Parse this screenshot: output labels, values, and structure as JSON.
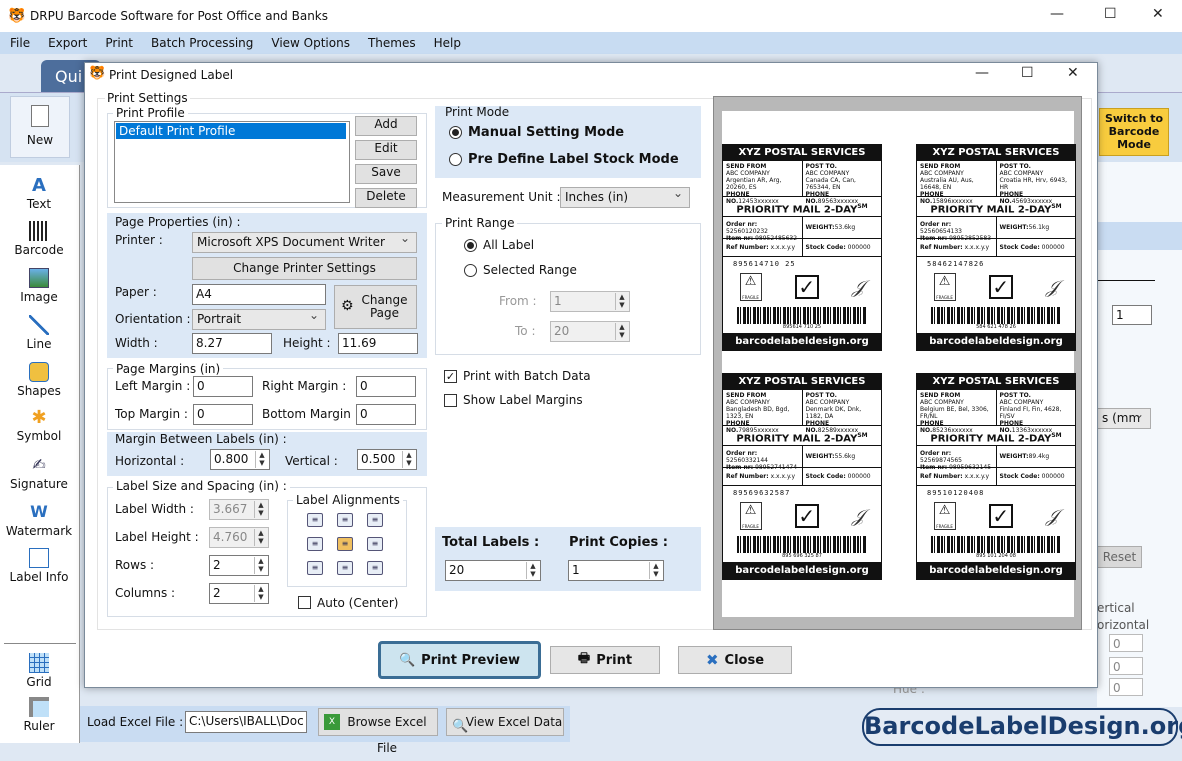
{
  "app": {
    "title": "DRPU Barcode Software for Post Office and Banks",
    "quick_tab": "Qui",
    "new_label": "New",
    "switch_mode": "Switch to Barcode Mode"
  },
  "menu": [
    "File",
    "Export",
    "Print",
    "Batch Processing",
    "View Options",
    "Themes",
    "Help"
  ],
  "sidebar": {
    "items": [
      "Text",
      "Barcode",
      "Image",
      "Line",
      "Shapes",
      "Symbol",
      "Signature",
      "Watermark",
      "Label Info"
    ],
    "bottom": [
      "Grid",
      "Ruler"
    ]
  },
  "background": {
    "load_excel_label": "Load Excel File :",
    "excel_path": "C:\\Users\\IBALL\\Doc",
    "browse_excel": "Browse Excel File",
    "view_excel": "View Excel Data",
    "right": {
      "reset": "Reset",
      "vertical": "ertical",
      "horizontal": "orizontal",
      "spin_value": "1",
      "units": "s (mm",
      "hue": "Hue :",
      "zero": "0"
    }
  },
  "dialog": {
    "title": "Print Designed Label",
    "print_settings": "Print Settings",
    "print_profile": {
      "title": "Print Profile",
      "items": [
        "Default Print Profile"
      ],
      "add": "Add",
      "edit": "Edit",
      "save": "Save",
      "delete": "Delete"
    },
    "page_properties": {
      "title": "Page Properties (in) :",
      "printer_label": "Printer :",
      "printer": "Microsoft XPS Document Writer",
      "change_printer": "Change Printer Settings",
      "paper_label": "Paper :",
      "paper": "A4",
      "change_page": "Change Page",
      "orientation_label": "Orientation :",
      "orientation": "Portrait",
      "width_label": "Width :",
      "width": "8.27",
      "height_label": "Height :",
      "height": "11.69"
    },
    "page_margins": {
      "title": "Page Margins (in)",
      "left_label": "Left Margin :",
      "left": "0",
      "right_label": "Right Margin :",
      "right": "0",
      "top_label": "Top Margin :",
      "top": "0",
      "bottom_label": "Bottom Margin :",
      "bottom": "0"
    },
    "margin_between": {
      "title": "Margin Between Labels (in) :",
      "horizontal_label": "Horizontal :",
      "horizontal": "0.800",
      "vertical_label": "Vertical :",
      "vertical": "0.500"
    },
    "label_size": {
      "title": "Label Size and Spacing (in) :",
      "width_label": "Label Width :",
      "width": "3.667",
      "height_label": "Label Height :",
      "height": "4.760",
      "rows_label": "Rows :",
      "rows": "2",
      "columns_label": "Columns :",
      "columns": "2",
      "alignments_title": "Label Alignments",
      "selected_alignment": "middle-center",
      "auto_center": "Auto (Center)"
    },
    "print_mode": {
      "title": "Print Mode",
      "manual": "Manual Setting Mode",
      "predefine": "Pre Define Label Stock Mode",
      "selected": "manual"
    },
    "measurement": {
      "label": "Measurement Unit :",
      "value": "Inches (in)"
    },
    "print_range": {
      "title": "Print Range",
      "all": "All Label",
      "selected": "Selected Range",
      "from_label": "From :",
      "from": "1",
      "to_label": "To :",
      "to": "20"
    },
    "batch": {
      "print_with_batch": "Print with Batch Data",
      "print_with_batch_checked": true,
      "show_margins": "Show Label Margins",
      "show_margins_checked": false
    },
    "totals": {
      "total_label": "Total Labels :",
      "total": "20",
      "copies_label": "Print Copies :",
      "copies": "1"
    },
    "buttons": {
      "preview": "Print Preview",
      "print": "Print",
      "close": "Close"
    }
  },
  "labels": [
    {
      "header": "XYZ POSTAL SERVICES",
      "send_from": "SEND FROM",
      "sender": "ABC COMPANY",
      "sender_addr": "Argentian AR, Arg, 20260, ES",
      "sender_phone_label": "PHONE NO.",
      "sender_phone": "12453xxxxxx",
      "post_to": "POST TO.",
      "recipient": "ABC COMPANY",
      "recipient_addr": "Canada CA, Can, 765344, EN",
      "recipient_phone_label": "PHONE NO.",
      "recipient_phone": "89563xxxxxx",
      "service": "PRIORITY MAIL 2-DAY",
      "sm": "SM",
      "order_label": "Order nr:",
      "order": "52560120232",
      "item_label": "Item nr:",
      "item": "98952485632",
      "weight_label": "WEIGHT:",
      "weight": "53.6kg",
      "ref_label": "Ref Number:",
      "ref": "x.x.x.y.y",
      "stock_label": "Stock Code:",
      "stock": "000000",
      "code": "895614710 25",
      "barcode_text": "895614 710 25",
      "fragile": "FRAGILE",
      "footer": "barcodelabeldesign.org"
    },
    {
      "header": "XYZ POSTAL SERVICES",
      "send_from": "SEND FROM",
      "sender": "ABC COMPANY",
      "sender_addr": "Australia AU, Aus, 16648, EN",
      "sender_phone_label": "PHONE NO.",
      "sender_phone": "15896xxxxxx",
      "post_to": "POST TO.",
      "recipient": "ABC COMPANY",
      "recipient_addr": "Croatia HR, Hrv, 6943, HR",
      "recipient_phone_label": "PHONE NO.",
      "recipient_phone": "45693xxxxxx",
      "service": "PRIORITY MAIL 2-DAY",
      "sm": "SM",
      "order_label": "Order nr:",
      "order": "52560654133",
      "item_label": "Item nr:",
      "item": "98952852583",
      "weight_label": "WEIGHT:",
      "weight": "56.1kg",
      "ref_label": "Ref Number:",
      "ref": "x.x.x.y.y",
      "stock_label": "Stock Code:",
      "stock": "000000",
      "code": "58462147826",
      "barcode_text": "584 621 478 26",
      "fragile": "FRAGILE",
      "footer": "barcodelabeldesign.org"
    },
    {
      "header": "XYZ POSTAL SERVICES",
      "send_from": "SEND FROM",
      "sender": "ABC COMPANY",
      "sender_addr": "Bangladesh BD, Bgd, 1323, EN",
      "sender_phone_label": "PHONE NO.",
      "sender_phone": "79895xxxxxx",
      "post_to": "POST TO.",
      "recipient": "ABC COMPANY",
      "recipient_addr": "Denmark DK, Dnk, 1182, DA",
      "recipient_phone_label": "PHONE NO.",
      "recipient_phone": "82589xxxxxx",
      "service": "PRIORITY MAIL 2-DAY",
      "sm": "SM",
      "order_label": "Order nr:",
      "order": "52560332144",
      "item_label": "Item nr:",
      "item": "98952741474",
      "weight_label": "WEIGHT:",
      "weight": "55.6kg",
      "ref_label": "Ref Number:",
      "ref": "x.x.x.y.y",
      "stock_label": "Stock Code:",
      "stock": "000000",
      "code": "89569632587",
      "barcode_text": "895 696 325 87",
      "fragile": "FRAGILE",
      "footer": "barcodelabeldesign.org"
    },
    {
      "header": "XYZ POSTAL SERVICES",
      "send_from": "SEND FROM",
      "sender": "ABC COMPANY",
      "sender_addr": "Belgium BE, Bel, 3306, FR/NL",
      "sender_phone_label": "PHONE NO.",
      "sender_phone": "85236xxxxxx",
      "post_to": "POST TO.",
      "recipient": "ABC COMPANY",
      "recipient_addr": "Finland FI, Fin, 4628, FI/SV",
      "recipient_phone_label": "PHONE NO.",
      "recipient_phone": "13363xxxxxx",
      "service": "PRIORITY MAIL 2-DAY",
      "sm": "SM",
      "order_label": "Order nr:",
      "order": "52569874565",
      "item_label": "Item nr:",
      "item": "98959632145",
      "weight_label": "WEIGHT:",
      "weight": "89.4kg",
      "ref_label": "Ref Number:",
      "ref": "x.x.x.y.y",
      "stock_label": "Stock Code:",
      "stock": "000000",
      "code": "89510120408",
      "barcode_text": "895 101 204 08",
      "fragile": "FRAGILE",
      "footer": "barcodelabeldesign.org"
    }
  ],
  "watermark": "BarcodeLabelDesign.org",
  "colors": {
    "accent": "#4d6e9c",
    "section_bg": "#dce8f6",
    "switch_btn": "#f8cc3e",
    "watermark": "#1a3d6e"
  }
}
